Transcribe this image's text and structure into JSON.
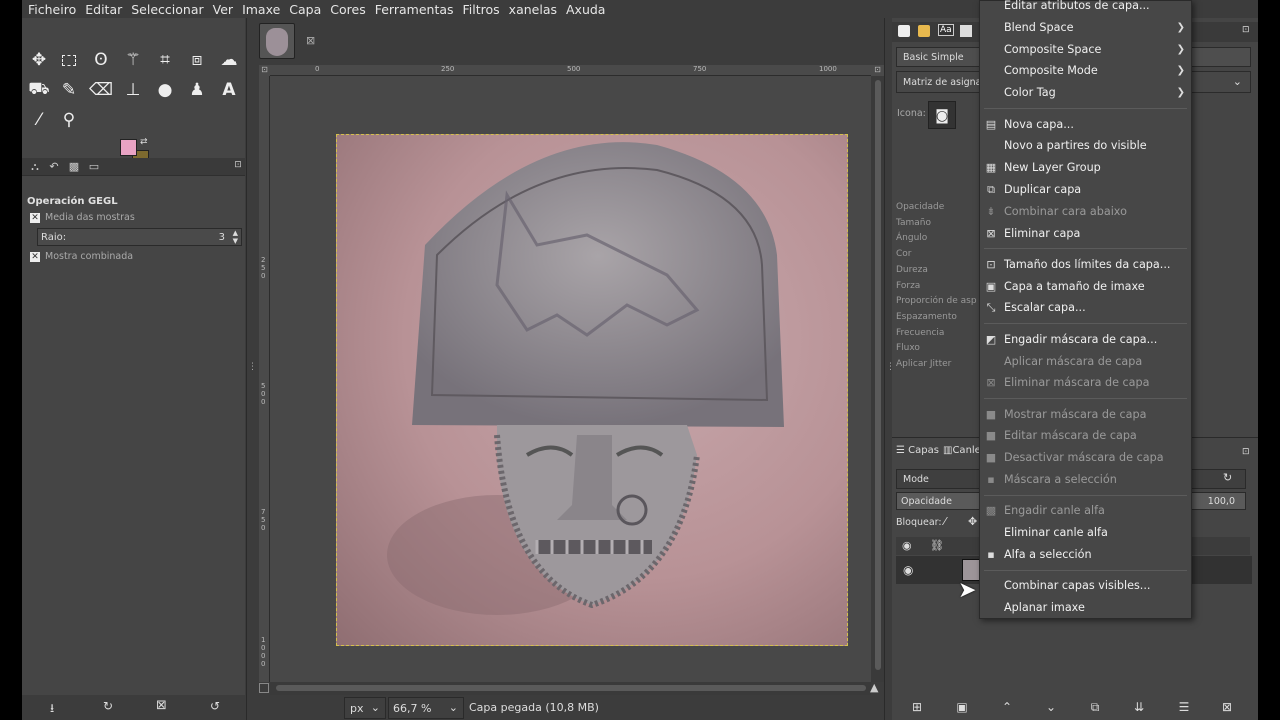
{
  "menubar": [
    "Ficheiro",
    "Editar",
    "Seleccionar",
    "Ver",
    "Imaxe",
    "Capa",
    "Cores",
    "Ferramentas",
    "Filtros",
    "xanelas",
    "Axuda"
  ],
  "tool_options": {
    "title": "Operación GEGL",
    "sample_average": "Media das mostras",
    "radius_label": "Raio:",
    "radius_value": "3",
    "sample_merged": "Mostra combinada"
  },
  "ruler": {
    "h": [
      "0",
      "250",
      "500",
      "750",
      "1000"
    ],
    "v": [
      "2",
      "5",
      "0",
      "5",
      "0",
      "0",
      "7",
      "5",
      "0",
      "1",
      "0",
      "0",
      "0"
    ]
  },
  "status": {
    "unit": "px",
    "zoom": "66,7 %",
    "message": "Capa pegada (10,8 MB)"
  },
  "brush_panel": {
    "brush_name": "Basic Simple",
    "dynamics": "Matriz de asigna",
    "icon_label": "Icona:",
    "params": [
      "Opacidade",
      "Tamaño",
      "Ángulo",
      "Cor",
      "Dureza",
      "Forza",
      "Proporción de asp",
      "Espazamento",
      "Frecuencia",
      "Fluxo",
      "Aplicar Jitter"
    ]
  },
  "layers_panel": {
    "tab_layers": "Capas",
    "tab_channels": "Canle",
    "mode_label": "Mode",
    "opacity_label": "Opacidade",
    "opacity_value": "100,0",
    "lock_label": "Bloquear:"
  },
  "context_menu": [
    {
      "label": "Editar atributos de capa...",
      "icon": "",
      "disabled": false
    },
    {
      "label": "Blend Space",
      "icon": "",
      "disabled": false,
      "submenu": true
    },
    {
      "label": "Composite Space",
      "icon": "",
      "disabled": false,
      "submenu": true
    },
    {
      "label": "Composite Mode",
      "icon": "",
      "disabled": false,
      "submenu": true
    },
    {
      "label": "Color Tag",
      "icon": "",
      "disabled": false,
      "submenu": true
    },
    {
      "sep": true
    },
    {
      "label": "Nova capa...",
      "icon": "new-layer-icon",
      "disabled": false
    },
    {
      "label": "Novo a partires do visible",
      "icon": "",
      "disabled": false
    },
    {
      "label": "New Layer Group",
      "icon": "layer-group-icon",
      "disabled": false
    },
    {
      "label": "Duplicar capa",
      "icon": "duplicate-icon",
      "disabled": false
    },
    {
      "label": "Combinar cara abaixo",
      "icon": "merge-down-icon",
      "disabled": true
    },
    {
      "label": "Eliminar capa",
      "icon": "delete-icon",
      "disabled": false
    },
    {
      "sep": true
    },
    {
      "label": "Tamaño dos límites da capa...",
      "icon": "boundary-size-icon",
      "disabled": false
    },
    {
      "label": "Capa a tamaño de imaxe",
      "icon": "layer-to-image-icon",
      "disabled": false
    },
    {
      "label": "Escalar capa...",
      "icon": "scale-icon",
      "disabled": false
    },
    {
      "sep": true
    },
    {
      "label": "Engadir máscara de capa...",
      "icon": "add-mask-icon",
      "disabled": false
    },
    {
      "label": "Aplicar máscara de capa",
      "icon": "",
      "disabled": true
    },
    {
      "label": "Eliminar máscara de capa",
      "icon": "delete-icon",
      "disabled": true
    },
    {
      "sep": true
    },
    {
      "label": "Mostrar máscara de capa",
      "icon": "checkbox-icon",
      "disabled": true
    },
    {
      "label": "Editar máscara de capa",
      "icon": "checkbox-icon",
      "disabled": true
    },
    {
      "label": "Desactivar máscara de capa",
      "icon": "checkbox-icon",
      "disabled": true
    },
    {
      "label": "Máscara a selección",
      "icon": "mask-selection-icon",
      "disabled": true
    },
    {
      "sep": true
    },
    {
      "label": "Engadir canle alfa",
      "icon": "add-alpha-icon",
      "disabled": true
    },
    {
      "label": "Eliminar canle alfa",
      "icon": "",
      "disabled": false
    },
    {
      "label": "Alfa a selección",
      "icon": "alpha-selection-icon",
      "disabled": false
    },
    {
      "sep": true
    },
    {
      "label": "Combinar capas visibles...",
      "icon": "",
      "disabled": false
    },
    {
      "label": "Aplanar imaxe",
      "icon": "",
      "disabled": false
    }
  ]
}
